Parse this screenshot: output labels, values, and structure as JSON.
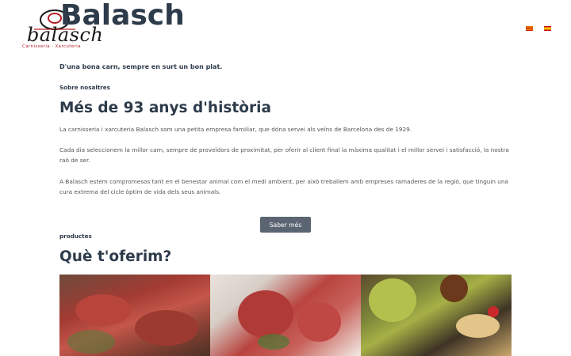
{
  "header": {
    "site_title": "Balasch",
    "logo": {
      "wordmark": "balasch",
      "tagline": "Carnisseria · Xarcuteria"
    },
    "languages": [
      "ca",
      "es"
    ]
  },
  "main": {
    "tagline": "D'una bona carn, sempre en surt un bon plat.",
    "about": {
      "kicker": "Sobre nosaltres",
      "heading": "Més de 93 anys d'història",
      "paragraphs": [
        "La carnisseria i xarcuteria Balasch som una petita empresa familiar, que dóna servei als veïns de Barcelona des de 1929.",
        "Cada dia seleccionem la millor carn, sempre de proveïdors de proximitat, per oferir al client final la màxima qualitat i el millor servei i satisfacció, la nostra raó de ser.",
        "A Balasch estem compromesos tant en el benestar animal com el medi ambient, per això treballem amb empreses ramaderes de la regió, que tinguin una cura extrema del cicle òptim de vida dels seus animals."
      ],
      "button_label": "Saber més"
    },
    "products": {
      "kicker": "productes",
      "heading": "Què t'oferim?"
    }
  },
  "colors": {
    "heading": "#2d3b4a",
    "button": "#5b6572",
    "logo_accent": "#b52025"
  }
}
